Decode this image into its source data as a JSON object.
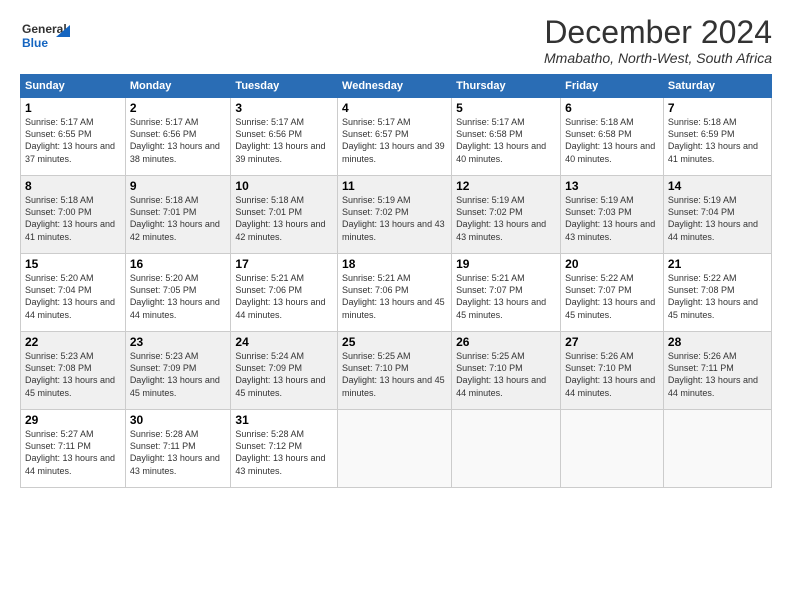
{
  "logo": {
    "line1": "General",
    "line2": "Blue"
  },
  "title": "December 2024",
  "subtitle": "Mmabatho, North-West, South Africa",
  "days": [
    "Sunday",
    "Monday",
    "Tuesday",
    "Wednesday",
    "Thursday",
    "Friday",
    "Saturday"
  ],
  "weeks": [
    [
      {
        "num": "1",
        "rise": "5:17 AM",
        "set": "6:55 PM",
        "daylight": "13 hours and 37 minutes."
      },
      {
        "num": "2",
        "rise": "5:17 AM",
        "set": "6:56 PM",
        "daylight": "13 hours and 38 minutes."
      },
      {
        "num": "3",
        "rise": "5:17 AM",
        "set": "6:56 PM",
        "daylight": "13 hours and 39 minutes."
      },
      {
        "num": "4",
        "rise": "5:17 AM",
        "set": "6:57 PM",
        "daylight": "13 hours and 39 minutes."
      },
      {
        "num": "5",
        "rise": "5:17 AM",
        "set": "6:58 PM",
        "daylight": "13 hours and 40 minutes."
      },
      {
        "num": "6",
        "rise": "5:18 AM",
        "set": "6:58 PM",
        "daylight": "13 hours and 40 minutes."
      },
      {
        "num": "7",
        "rise": "5:18 AM",
        "set": "6:59 PM",
        "daylight": "13 hours and 41 minutes."
      }
    ],
    [
      {
        "num": "8",
        "rise": "5:18 AM",
        "set": "7:00 PM",
        "daylight": "13 hours and 41 minutes."
      },
      {
        "num": "9",
        "rise": "5:18 AM",
        "set": "7:01 PM",
        "daylight": "13 hours and 42 minutes."
      },
      {
        "num": "10",
        "rise": "5:18 AM",
        "set": "7:01 PM",
        "daylight": "13 hours and 42 minutes."
      },
      {
        "num": "11",
        "rise": "5:19 AM",
        "set": "7:02 PM",
        "daylight": "13 hours and 43 minutes."
      },
      {
        "num": "12",
        "rise": "5:19 AM",
        "set": "7:02 PM",
        "daylight": "13 hours and 43 minutes."
      },
      {
        "num": "13",
        "rise": "5:19 AM",
        "set": "7:03 PM",
        "daylight": "13 hours and 43 minutes."
      },
      {
        "num": "14",
        "rise": "5:19 AM",
        "set": "7:04 PM",
        "daylight": "13 hours and 44 minutes."
      }
    ],
    [
      {
        "num": "15",
        "rise": "5:20 AM",
        "set": "7:04 PM",
        "daylight": "13 hours and 44 minutes."
      },
      {
        "num": "16",
        "rise": "5:20 AM",
        "set": "7:05 PM",
        "daylight": "13 hours and 44 minutes."
      },
      {
        "num": "17",
        "rise": "5:21 AM",
        "set": "7:06 PM",
        "daylight": "13 hours and 44 minutes."
      },
      {
        "num": "18",
        "rise": "5:21 AM",
        "set": "7:06 PM",
        "daylight": "13 hours and 45 minutes."
      },
      {
        "num": "19",
        "rise": "5:21 AM",
        "set": "7:07 PM",
        "daylight": "13 hours and 45 minutes."
      },
      {
        "num": "20",
        "rise": "5:22 AM",
        "set": "7:07 PM",
        "daylight": "13 hours and 45 minutes."
      },
      {
        "num": "21",
        "rise": "5:22 AM",
        "set": "7:08 PM",
        "daylight": "13 hours and 45 minutes."
      }
    ],
    [
      {
        "num": "22",
        "rise": "5:23 AM",
        "set": "7:08 PM",
        "daylight": "13 hours and 45 minutes."
      },
      {
        "num": "23",
        "rise": "5:23 AM",
        "set": "7:09 PM",
        "daylight": "13 hours and 45 minutes."
      },
      {
        "num": "24",
        "rise": "5:24 AM",
        "set": "7:09 PM",
        "daylight": "13 hours and 45 minutes."
      },
      {
        "num": "25",
        "rise": "5:25 AM",
        "set": "7:10 PM",
        "daylight": "13 hours and 45 minutes."
      },
      {
        "num": "26",
        "rise": "5:25 AM",
        "set": "7:10 PM",
        "daylight": "13 hours and 44 minutes."
      },
      {
        "num": "27",
        "rise": "5:26 AM",
        "set": "7:10 PM",
        "daylight": "13 hours and 44 minutes."
      },
      {
        "num": "28",
        "rise": "5:26 AM",
        "set": "7:11 PM",
        "daylight": "13 hours and 44 minutes."
      }
    ],
    [
      {
        "num": "29",
        "rise": "5:27 AM",
        "set": "7:11 PM",
        "daylight": "13 hours and 44 minutes."
      },
      {
        "num": "30",
        "rise": "5:28 AM",
        "set": "7:11 PM",
        "daylight": "13 hours and 43 minutes."
      },
      {
        "num": "31",
        "rise": "5:28 AM",
        "set": "7:12 PM",
        "daylight": "13 hours and 43 minutes."
      },
      null,
      null,
      null,
      null
    ]
  ]
}
